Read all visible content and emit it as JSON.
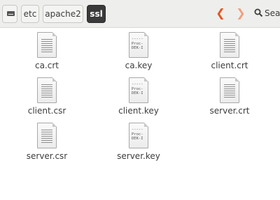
{
  "toolbar": {
    "breadcrumbs": [
      {
        "label": ""
      },
      {
        "label": "etc"
      },
      {
        "label": "apache2"
      },
      {
        "label": "ssl"
      }
    ],
    "back_glyph": "❮",
    "forward_glyph": "❯",
    "search_label": "Sea",
    "accent_color": "#e95420"
  },
  "files": [
    {
      "name": "ca.crt",
      "icon": "text-document-icon"
    },
    {
      "name": "ca.key",
      "icon": "key-document-icon",
      "preview": "-----\nProc-\nDEK-I"
    },
    {
      "name": "client.crt",
      "icon": "text-document-icon"
    },
    {
      "name": "client.csr",
      "icon": "text-document-icon"
    },
    {
      "name": "client.key",
      "icon": "key-document-icon",
      "preview": "-----\nProc-\nDEK-I"
    },
    {
      "name": "server.crt",
      "icon": "text-document-icon"
    },
    {
      "name": "server.csr",
      "icon": "text-document-icon"
    },
    {
      "name": "server.key",
      "icon": "key-document-icon",
      "preview": "-----\nProc-\nDEK-I"
    }
  ]
}
